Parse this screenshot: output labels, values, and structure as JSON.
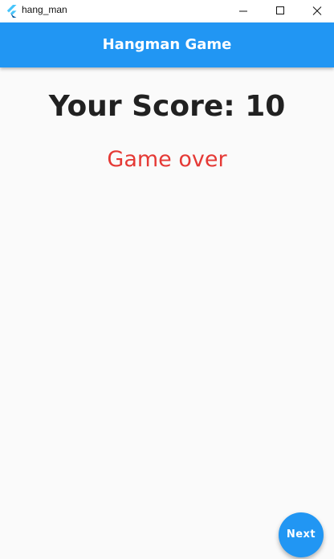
{
  "window": {
    "title": "hang_man",
    "icon": "flutter-logo-icon",
    "controls": [
      "minimize-icon",
      "maximize-icon",
      "close-icon"
    ]
  },
  "appbar": {
    "title": "Hangman Game"
  },
  "main": {
    "score_text": "Your Score: 10",
    "status_text": "Game over"
  },
  "fab": {
    "label": "Next"
  },
  "colors": {
    "primary": "#2196f3",
    "status": "#e53935",
    "score_text": "#212121",
    "background": "#fafafa"
  }
}
